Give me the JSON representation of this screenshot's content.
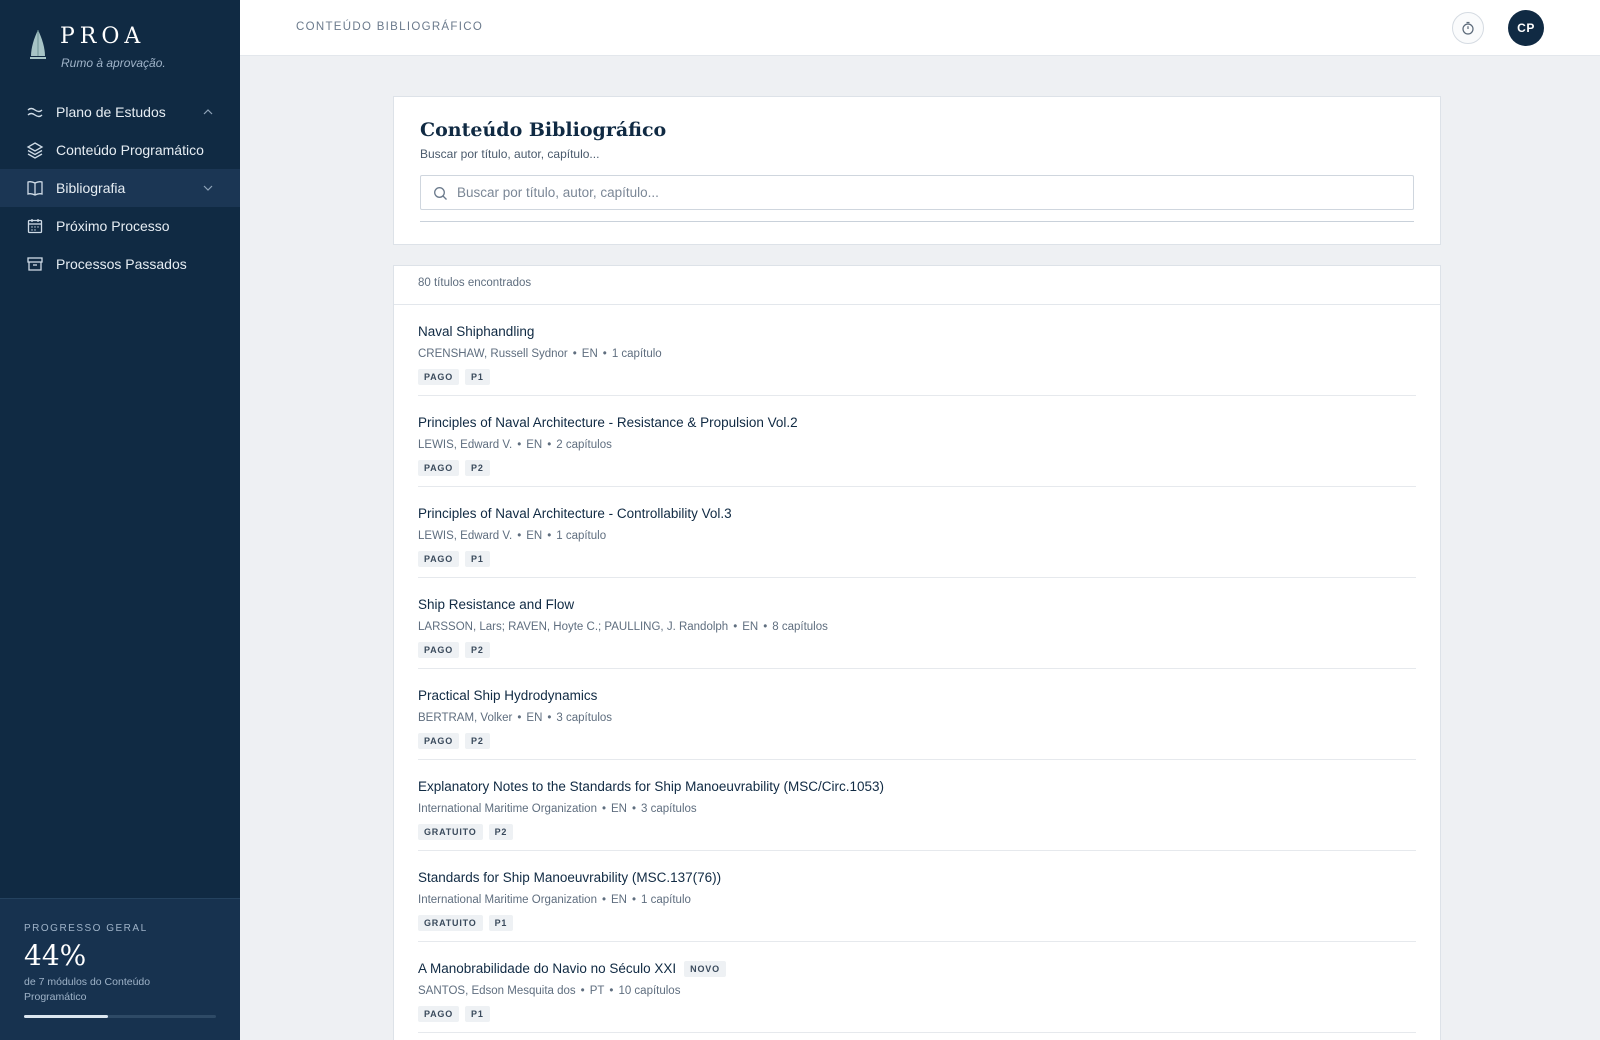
{
  "brand": {
    "name": "PROA",
    "tagline": "Rumo à aprovação."
  },
  "sidebar": {
    "items": [
      {
        "label": "Plano de Estudos",
        "icon": "wave-icon",
        "chevron": "up"
      },
      {
        "label": "Conteúdo Programático",
        "icon": "layers-icon",
        "chevron": ""
      },
      {
        "label": "Bibliografia",
        "icon": "book-icon",
        "chevron": "down",
        "active": true
      },
      {
        "label": "Próximo Processo",
        "icon": "calendar-icon",
        "chevron": ""
      },
      {
        "label": "Processos Passados",
        "icon": "archive-icon",
        "chevron": ""
      }
    ],
    "progress": {
      "label": "PROGRESSO GERAL",
      "value": "44%",
      "sub": "de 7 módulos do Conteúdo Programático",
      "fraction": 0.44
    }
  },
  "header": {
    "breadcrumb": "CONTEÚDO BIBLIOGRÁFICO",
    "avatar": "CP",
    "timer_icon": "timer-icon"
  },
  "search": {
    "title": "Conteúdo Bibliográfico",
    "subtitle": "Buscar por título, autor, capítulo...",
    "placeholder": "Buscar por título, autor, capítulo..."
  },
  "results": {
    "count": "80 títulos encontrados",
    "items": [
      {
        "title": "Naval Shiphandling",
        "badge": "",
        "author": "CRENSHAW, Russell Sydnor",
        "lang": "EN",
        "chapters": "1 capítulo",
        "tags": [
          "PAGO",
          "P1"
        ]
      },
      {
        "title": "Principles of Naval Architecture - Resistance & Propulsion Vol.2",
        "badge": "",
        "author": "LEWIS, Edward V.",
        "lang": "EN",
        "chapters": "2 capítulos",
        "tags": [
          "PAGO",
          "P2"
        ]
      },
      {
        "title": "Principles of Naval Architecture - Controllability Vol.3",
        "badge": "",
        "author": "LEWIS, Edward V.",
        "lang": "EN",
        "chapters": "1 capítulo",
        "tags": [
          "PAGO",
          "P1"
        ]
      },
      {
        "title": "Ship Resistance and Flow",
        "badge": "",
        "author": "LARSSON, Lars; RAVEN, Hoyte C.; PAULLING, J. Randolph",
        "lang": "EN",
        "chapters": "8 capítulos",
        "tags": [
          "PAGO",
          "P2"
        ]
      },
      {
        "title": "Practical Ship Hydrodynamics",
        "badge": "",
        "author": "BERTRAM, Volker",
        "lang": "EN",
        "chapters": "3 capítulos",
        "tags": [
          "PAGO",
          "P2"
        ]
      },
      {
        "title": "Explanatory Notes to the Standards for Ship Manoeuvrability (MSC/Circ.1053)",
        "badge": "",
        "author": "International Maritime Organization",
        "lang": "EN",
        "chapters": "3 capítulos",
        "tags": [
          "GRATUITO",
          "P2"
        ]
      },
      {
        "title": "Standards for Ship Manoeuvrability (MSC.137(76))",
        "badge": "",
        "author": "International Maritime Organization",
        "lang": "EN",
        "chapters": "1 capítulo",
        "tags": [
          "GRATUITO",
          "P1"
        ]
      },
      {
        "title": "A Manobrabilidade do Navio no Século XXI",
        "badge": "NOVO",
        "author": "SANTOS, Edson Mesquita dos",
        "lang": "PT",
        "chapters": "10 capítulos",
        "tags": [
          "PAGO",
          "P1"
        ]
      }
    ]
  }
}
